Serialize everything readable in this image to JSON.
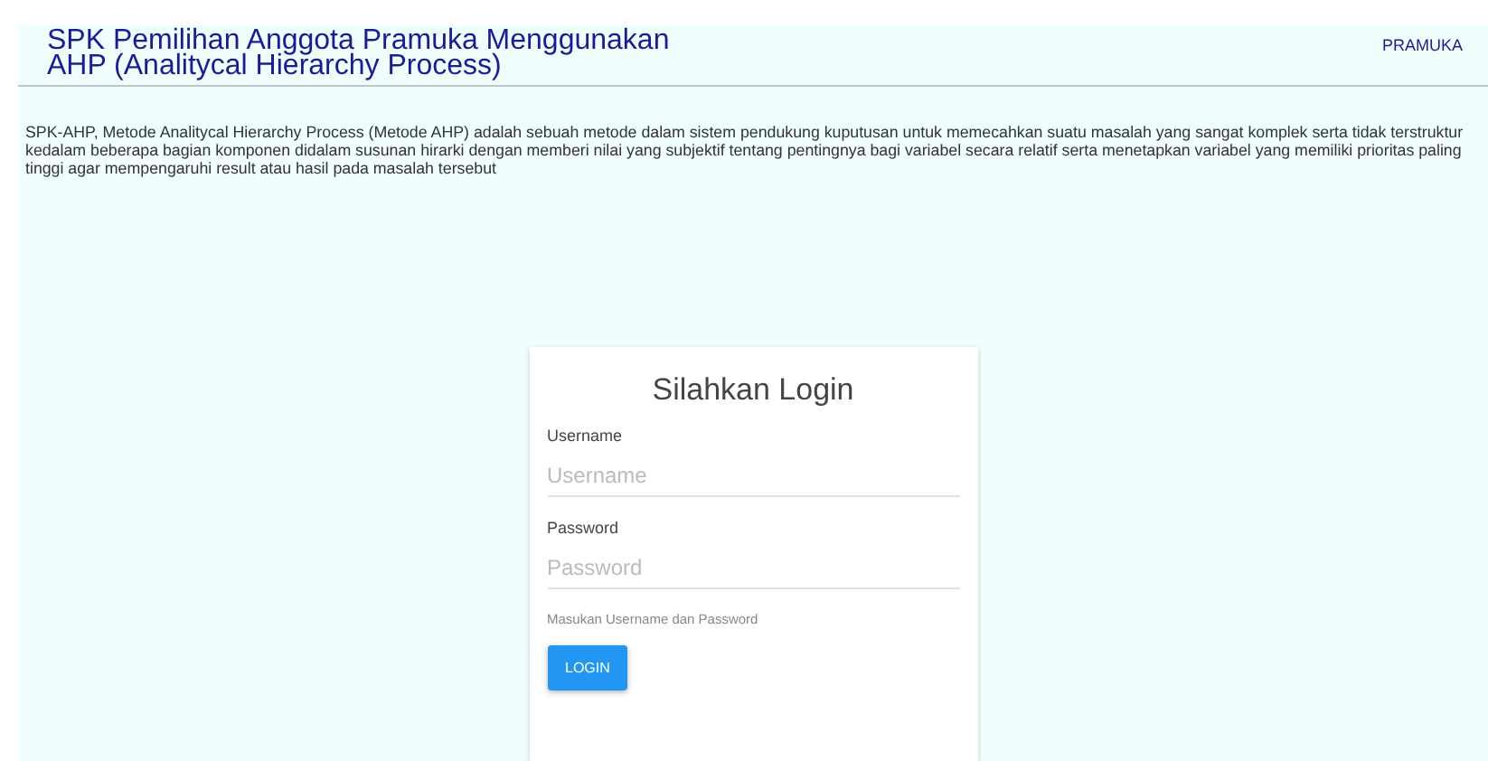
{
  "header": {
    "title_lines": [
      "SPK Pemilihan Anggota Pramuka Menggunakan",
      "AHP (Analitycal Hierarchy Process)"
    ],
    "nav_link": "PRAMUKA"
  },
  "description": "SPK-AHP, Metode Analitycal Hierarchy Process (Metode AHP) adalah sebuah metode dalam sistem pendukung kuputusan untuk memecahkan suatu masalah yang sangat komplek serta tidak terstruktur kedalam beberapa bagian komponen didalam susunan hirarki dengan memberi nilai yang subjektif tentang pentingnya bagi variabel secara relatif serta menetapkan variabel yang memiliki prioritas paling tinggi agar mempengaruhi result atau hasil pada masalah tersebut",
  "login": {
    "title": "Silahkan Login",
    "fields": [
      {
        "label": "Username",
        "placeholder": "Username"
      },
      {
        "label": "Password",
        "placeholder": "Password"
      }
    ],
    "hint": "Masukan Username dan Password",
    "button": "LOGIN"
  }
}
